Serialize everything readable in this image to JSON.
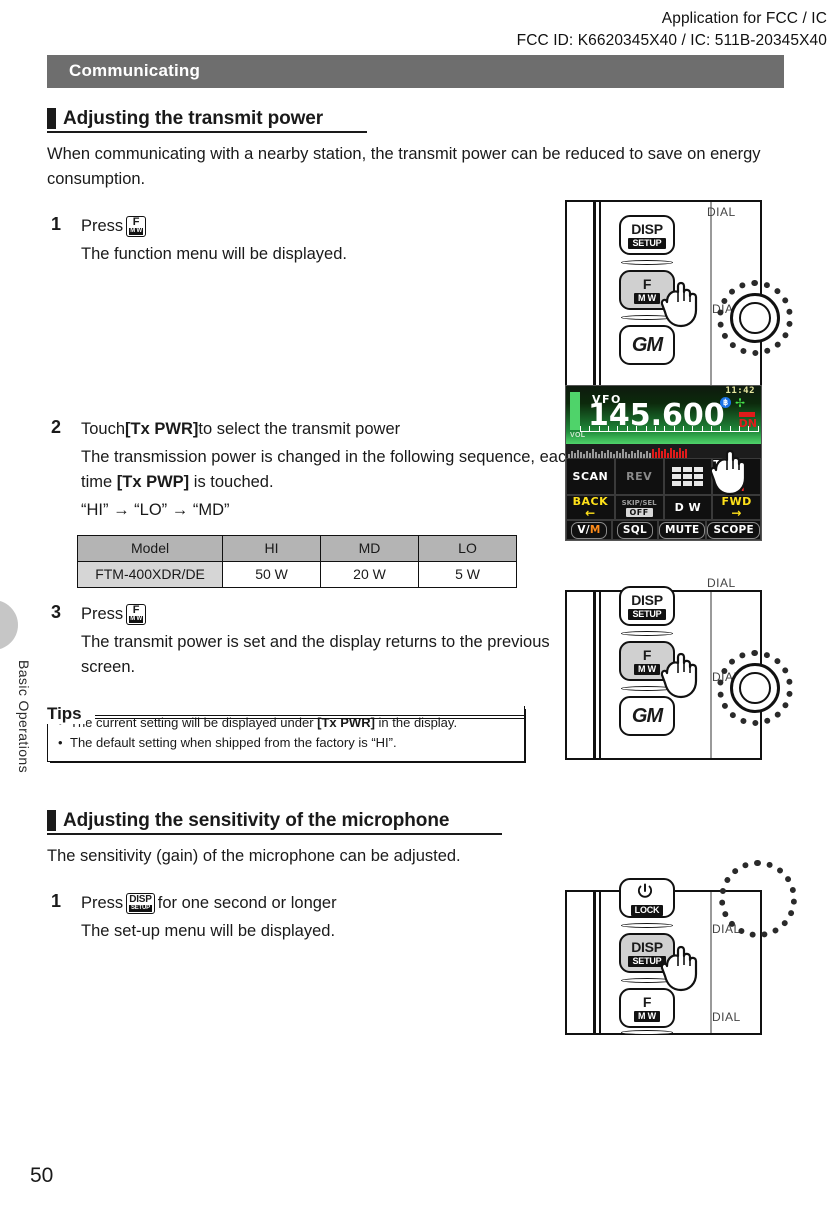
{
  "header": {
    "line1": "Application for FCC / IC",
    "line2": "FCC ID: K6620345X40 / IC: 511B-20345X40"
  },
  "sidebar": {
    "tab_label": "Basic Operations"
  },
  "page": {
    "number": "50"
  },
  "chapter": {
    "title": "Communicating"
  },
  "section1": {
    "title": "Adjusting the transmit power",
    "intro": "When communicating with a nearby station, the transmit power can be reduced to save on energy consumption.",
    "steps": [
      {
        "num": "1",
        "title_pre": "Press",
        "icon": "f-mw-key-icon",
        "icon_top": "F",
        "icon_bottom": "M W",
        "desc": "The function menu will be displayed."
      },
      {
        "num": "2",
        "title_pre": "Touch ",
        "title_key": "[Tx PWR]",
        "title_post": " to select the transmit power",
        "desc_a": "The transmission power is changed in the following sequence, each time ",
        "desc_key": "[Tx PWP]",
        "desc_b": " is touched.",
        "sequence": "“HI” → “LO” → “MD”"
      },
      {
        "num": "3",
        "title_pre": "Press",
        "icon": "f-mw-key-icon",
        "icon_top": "F",
        "icon_bottom": "M W",
        "desc": "The transmit power is set and the display returns to the previous screen."
      }
    ],
    "table": {
      "headers": [
        "Model",
        "HI",
        "MD",
        "LO"
      ],
      "rows": [
        [
          "FTM-400XDR/DE",
          "50 W",
          "20 W",
          "5 W"
        ]
      ]
    },
    "tips": {
      "label": "Tips",
      "items": [
        {
          "pre": "The current setting will be displayed under ",
          "key": "[Tx PWR]",
          "post": " in the display."
        },
        {
          "pre": "The default setting when shipped from the factory is “HI”.",
          "key": "",
          "post": ""
        }
      ]
    }
  },
  "section2": {
    "title": "Adjusting the sensitivity of the microphone",
    "intro": "The sensitivity (gain) of the microphone can be adjusted.",
    "steps": [
      {
        "num": "1",
        "title_pre": "Press",
        "title_post": "for one second or longer",
        "icon": "disp-setup-key-icon",
        "icon_top": "DISP",
        "icon_bottom": "SETUP",
        "desc": "The set-up menu will be displayed."
      }
    ]
  },
  "illustrations": {
    "panel_a": {
      "buttons": [
        {
          "top": "DISP",
          "bottom": "SETUP",
          "pressed": false
        },
        {
          "top": "F",
          "bottom": "M W",
          "pressed": true
        },
        {
          "top": "GM",
          "bottom": "",
          "pressed": false
        }
      ],
      "dial_labels": [
        "DIAL",
        "DIAL"
      ]
    },
    "panel_b": {
      "buttons": [
        {
          "top": "",
          "bottom": "LOCK",
          "pressed": false
        },
        {
          "top": "DISP",
          "bottom": "SETUP",
          "pressed": true
        },
        {
          "top": "F",
          "bottom": "M W",
          "pressed": false
        }
      ],
      "dial_labels": [
        "DIAL",
        "DIAL"
      ]
    }
  },
  "lcd": {
    "clock": "11:42",
    "mode": "VFO",
    "frequency": "145.600",
    "vol_label": "VOL",
    "mode_indicator": "DN",
    "bluetooth_icon": "bluetooth-icon",
    "gps_icon": "gps-icon",
    "keys_row1": [
      {
        "label": "SCAN",
        "style": "normal"
      },
      {
        "label": "REV",
        "style": "dim"
      },
      {
        "label": "",
        "style": "keypad"
      },
      {
        "label": "Tx PWR",
        "sub": "H I",
        "style": "txpwr"
      }
    ],
    "keys_row2": [
      {
        "label": "BACK",
        "sub": "←",
        "style": "yellow"
      },
      {
        "label": "SKIP/SEL",
        "sub": "OFF",
        "style": "chip"
      },
      {
        "label": "D W",
        "style": "normal"
      },
      {
        "label": "FWD",
        "sub": "→",
        "style": "yellow"
      }
    ],
    "keys_row3": [
      {
        "label": "V/M",
        "style": "pill-vm"
      },
      {
        "label": "SQL",
        "style": "pill"
      },
      {
        "label": "MUTE",
        "style": "pill"
      },
      {
        "label": "SCOPE",
        "style": "pill"
      }
    ]
  },
  "colors": {
    "chapter_bar": "#6e6e6e",
    "table_header": "#b4b4b4",
    "table_rowhead": "#d6d6d6",
    "lcd_green": "#4fd36a",
    "lcd_red": "#e01b1b",
    "lcd_yellow": "#ffe11a",
    "lcd_orange": "#ff8c1a"
  }
}
